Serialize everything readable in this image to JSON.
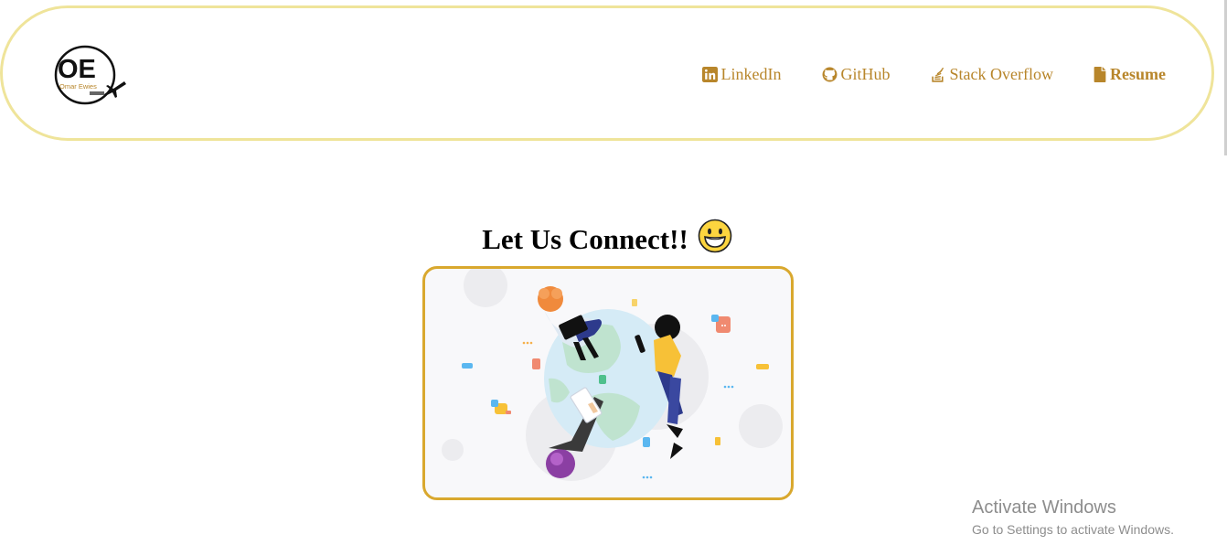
{
  "header": {
    "logo": {
      "initials": "OE",
      "subtitle": "Omar Ewies"
    },
    "nav": [
      {
        "label": "LinkedIn",
        "icon": "linkedin-icon"
      },
      {
        "label": "GitHub",
        "icon": "github-icon"
      },
      {
        "label": "Stack Overflow",
        "icon": "stackoverflow-icon"
      },
      {
        "label": "Resume",
        "icon": "file-icon"
      }
    ]
  },
  "main": {
    "title": "Let Us Connect!!",
    "emoji": "😀"
  },
  "watermark": {
    "line1": "Activate Windows",
    "line2": "Go to Settings to activate Windows."
  },
  "colors": {
    "accent": "#b8862b",
    "header_border": "#efe49a",
    "card_border": "#d9a82e"
  }
}
